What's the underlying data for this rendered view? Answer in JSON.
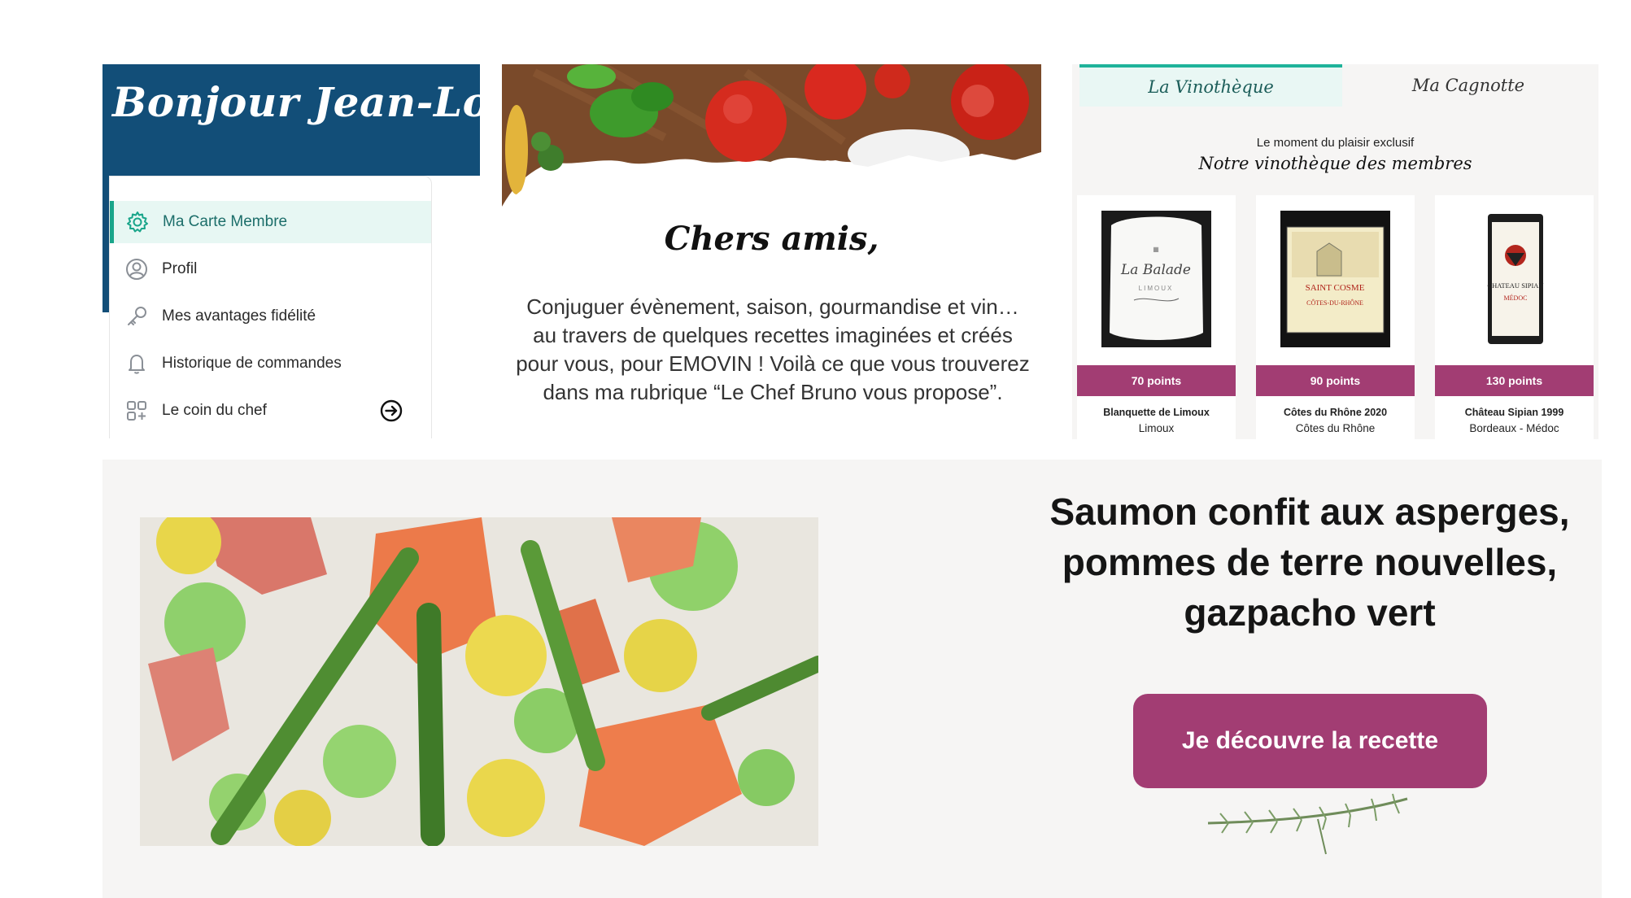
{
  "greeting": {
    "text": "Bonjour Jean-Louis !"
  },
  "menu": {
    "items": [
      {
        "label": "Ma Carte Membre",
        "icon": "gear-icon",
        "active": true
      },
      {
        "label": "Profil",
        "icon": "user-circle-icon",
        "active": false
      },
      {
        "label": "Mes avantages fidélité",
        "icon": "key-icon",
        "active": false
      },
      {
        "label": "Historique de commandes",
        "icon": "bell-icon",
        "active": false
      },
      {
        "label": "Le coin du chef",
        "icon": "grid-plus-icon",
        "active": false,
        "trailing_icon": "arrow-circle-right-icon"
      }
    ]
  },
  "intro": {
    "title": "Chers amis,",
    "body": "Conjuguer évènement, saison, gourmandise et vin… au travers de quelques recettes imaginées et créés pour vous, pour EMOVIN ! Voilà ce que vous trouverez dans ma rubrique “Le Chef Bruno vous propose”."
  },
  "vinotheque": {
    "tabs": [
      {
        "label": "La Vinothèque",
        "active": true
      },
      {
        "label": "Ma Cagnotte",
        "active": false
      }
    ],
    "subtitle": "Le moment du plaisir exclusif",
    "heading": "Notre vinothèque des membres",
    "wines": [
      {
        "points": "70 points",
        "name": "Blanquette de Limoux",
        "region": "Limoux",
        "label_text": "La Balade",
        "label_sub": "LIMOUX"
      },
      {
        "points": "90 points",
        "name": "Côtes du Rhône 2020",
        "region": "Côtes du Rhône",
        "label_text": "SAINT COSME",
        "label_sub": "CÔTES-DU-RHÔNE"
      },
      {
        "points": "130 points",
        "name": "Château Sipian 1999",
        "region": "Bordeaux - Médoc",
        "label_text": "CHATEAU SIPIAN",
        "label_sub": "MÉDOC"
      }
    ]
  },
  "recipe": {
    "title": "Saumon confit aux asperges, pommes de terre nouvelles, gazpacho vert",
    "button_label": "Je découvre la recette"
  },
  "colors": {
    "navy": "#124e78",
    "teal": "#19a58a",
    "plum": "#a23d73",
    "panel_bg": "#f6f5f4"
  }
}
